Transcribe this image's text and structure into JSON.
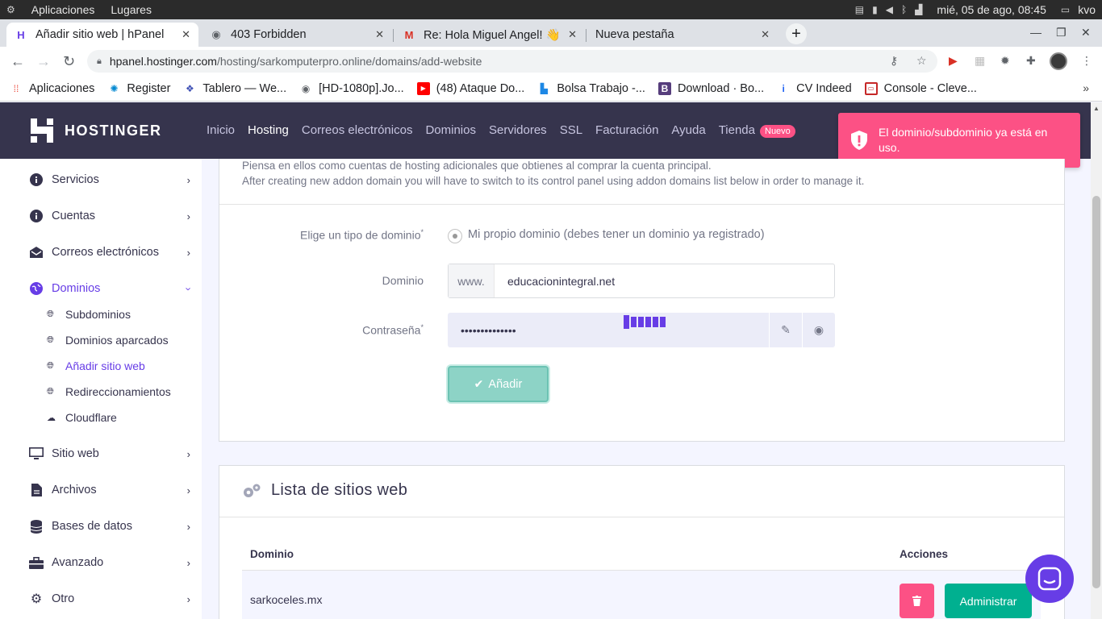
{
  "system": {
    "apps_menu": "Aplicaciones",
    "places_menu": "Lugares",
    "clock": "mié, 05 de ago, 08:45",
    "user": "kvo"
  },
  "browser": {
    "tabs": [
      {
        "title": "Añadir sitio web | hPanel",
        "active": true
      },
      {
        "title": "403 Forbidden"
      },
      {
        "title": "Re: Hola Miguel Angel! 👋"
      },
      {
        "title": "Nueva pestaña"
      }
    ],
    "url_host": "hpanel.hostinger.com",
    "url_path": "/hosting/sarkomputerpro.online/domains/add-website",
    "bookmarks": [
      {
        "label": "Aplicaciones",
        "icon": "apps-grid-icon"
      },
      {
        "label": "Register",
        "icon": "react-icon"
      },
      {
        "label": "Tablero — We...",
        "icon": "board-icon"
      },
      {
        "label": "[HD-1080p].Jo...",
        "icon": "globe-icon"
      },
      {
        "label": "(48) Ataque Do...",
        "icon": "youtube-icon"
      },
      {
        "label": "Bolsa Trabajo -...",
        "icon": "bar-chart-icon"
      },
      {
        "label": "Download · Bo...",
        "icon": "bootstrap-icon"
      },
      {
        "label": "CV Indeed",
        "icon": "indeed-icon"
      },
      {
        "label": "Console - Cleve...",
        "icon": "console-icon"
      }
    ]
  },
  "header": {
    "brand": "HOSTINGER",
    "nav": [
      "Inicio",
      "Hosting",
      "Correos electrónicos",
      "Dominios",
      "Servidores",
      "SSL",
      "Facturación",
      "Ayuda"
    ],
    "store": "Tienda",
    "store_badge": "Nuevo"
  },
  "toast": {
    "message": "El dominio/subdominio ya está en uso.",
    "color": "#fc5185"
  },
  "sidebar": {
    "items": [
      {
        "label": "Servicios",
        "icon": "info-icon"
      },
      {
        "label": "Cuentas",
        "icon": "info-icon"
      },
      {
        "label": "Correos electrónicos",
        "icon": "envelope-icon"
      },
      {
        "label": "Dominios",
        "icon": "globe-icon",
        "open": true
      },
      {
        "label": "Sitio web",
        "icon": "monitor-icon"
      },
      {
        "label": "Archivos",
        "icon": "file-icon"
      },
      {
        "label": "Bases de datos",
        "icon": "database-icon"
      },
      {
        "label": "Avanzado",
        "icon": "toolbox-icon"
      },
      {
        "label": "Otro",
        "icon": "gears-icon"
      }
    ],
    "sub_items": [
      {
        "label": "Subdominios"
      },
      {
        "label": "Dominios aparcados"
      },
      {
        "label": "Añadir sitio web",
        "active": true
      },
      {
        "label": "Redireccionamientos"
      },
      {
        "label": "Cloudflare"
      }
    ]
  },
  "form": {
    "intro_line1": "Piensa en ellos como cuentas de hosting adicionales que obtienes al comprar la cuenta principal.",
    "intro_line2": "After creating new addon domain you will have to switch to its control panel using addon domains list below in order to manage it.",
    "type_label": "Elige un tipo de dominio",
    "type_option": "Mi propio dominio (debes tener un dominio ya registrado)",
    "domain_label": "Dominio",
    "domain_prefix": "www.",
    "domain_value": "educacionintegral.net",
    "password_label": "Contraseña",
    "password_value": "••••••••••••••",
    "submit_label": "Añadir",
    "required_mark": "*"
  },
  "sites": {
    "title": "Lista de sitios web",
    "col_domain": "Dominio",
    "col_actions": "Acciones",
    "rows": [
      {
        "domain": "sarkoceles.mx",
        "manage_label": "Administrar"
      }
    ]
  },
  "colors": {
    "brand_purple": "#673de6",
    "header_bg": "#36344d",
    "danger": "#fc5185",
    "success": "#00b090"
  }
}
